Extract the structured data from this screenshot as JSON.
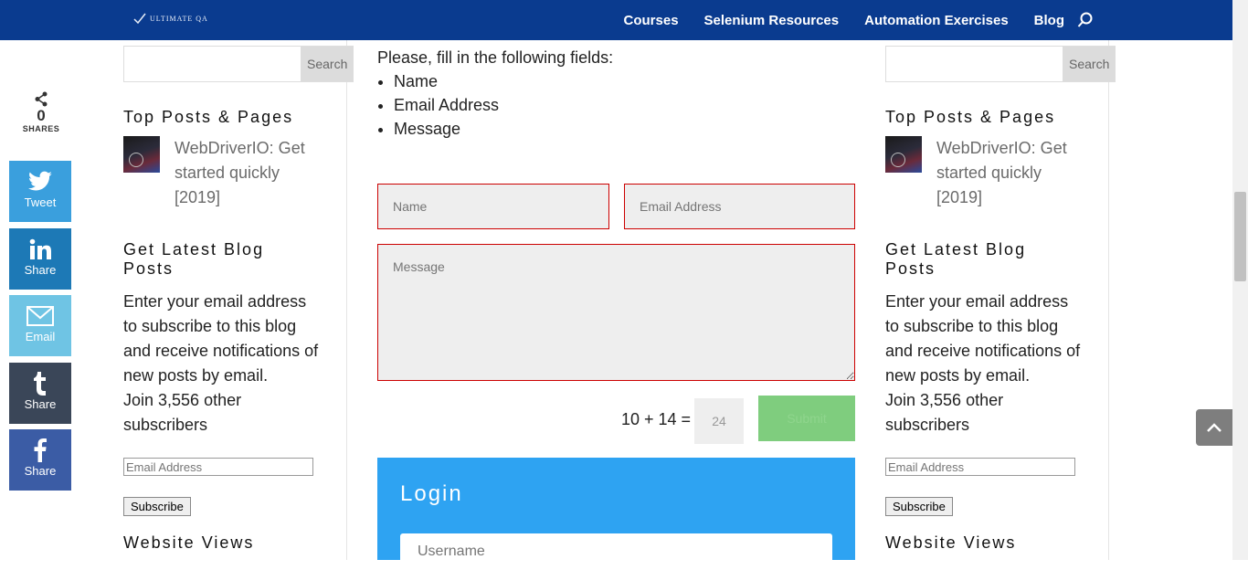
{
  "header": {
    "logo_text": "ULTIMATE QA",
    "nav": [
      "Courses",
      "Selenium Resources",
      "Automation Exercises",
      "Blog"
    ],
    "search_icon": "search-icon",
    "bg_color": "#0a3b8f"
  },
  "share_bar": {
    "count": "0",
    "count_label": "SHARES",
    "buttons": [
      {
        "label": "Tweet",
        "icon": "twitter-icon",
        "color": "#3a9fdd"
      },
      {
        "label": "Share",
        "icon": "linkedin-icon",
        "color": "#1d79b6"
      },
      {
        "label": "Email",
        "icon": "email-icon",
        "color": "#6fc4e4"
      },
      {
        "label": "Share",
        "icon": "tumblr-icon",
        "color": "#3a4658"
      },
      {
        "label": "Share",
        "icon": "facebook-icon",
        "color": "#3b5ca5"
      }
    ]
  },
  "sidebar": {
    "search_button": "Search",
    "top_posts_title": "Top Posts & Pages",
    "top_post_link": "WebDriverIO: Get started quickly [2019]",
    "blog_title": "Get Latest Blog Posts",
    "blog_text": "Enter your email address to subscribe to this blog and receive notifications of new posts by email.",
    "join_text": "Join 3,556 other subscribers",
    "email_placeholder": "Email Address",
    "subscribe_button": "Subscribe",
    "views_title": "Website Views"
  },
  "form": {
    "intro": "Please, fill in the following fields:",
    "fields_list": [
      "Name",
      "Email Address",
      "Message"
    ],
    "name_placeholder": "Name",
    "email_placeholder": "Email Address",
    "message_placeholder": "Message",
    "captcha_question": "10 + 14 =",
    "captcha_answer": "24",
    "submit_label": "Submit"
  },
  "login": {
    "title": "Login",
    "username_placeholder": "Username"
  }
}
